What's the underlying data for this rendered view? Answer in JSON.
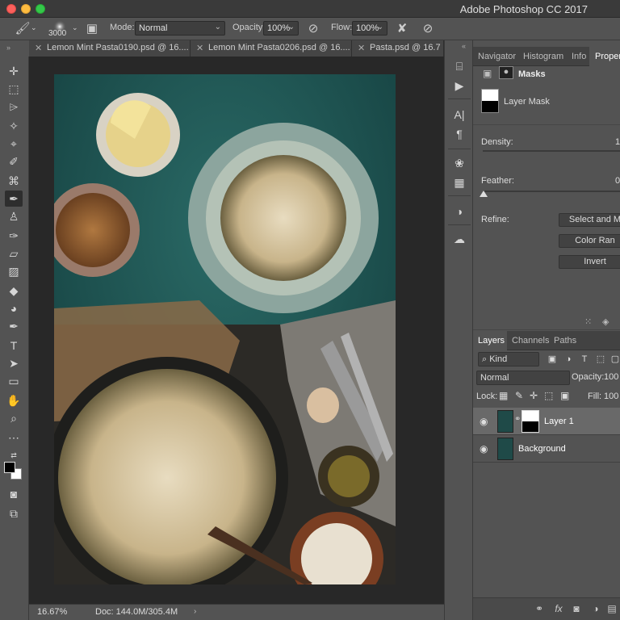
{
  "window": {
    "title": "Adobe Photoshop CC 2017"
  },
  "options": {
    "brush_size": "3000",
    "mode_label": "Mode:",
    "mode_value": "Normal",
    "opacity_label": "Opacity:",
    "opacity_value": "100%",
    "flow_label": "Flow:",
    "flow_value": "100%"
  },
  "tabs": [
    {
      "label": "Lemon Mint Pasta0190.psd @ 16....",
      "active": false
    },
    {
      "label": "Lemon Mint Pasta0206.psd @ 16....",
      "active": true
    },
    {
      "label": "Pasta.psd @ 16.7",
      "active": false
    }
  ],
  "status": {
    "zoom": "16.67%",
    "doc": "Doc: 144.0M/305.4M"
  },
  "top_panel_tabs": [
    "Navigator",
    "Histogram",
    "Info",
    "Properties"
  ],
  "properties": {
    "masks_title": "Masks",
    "layer_mask_label": "Layer Mask",
    "density_label": "Density:",
    "density_value": "1",
    "feather_label": "Feather:",
    "feather_value": "0",
    "refine_label": "Refine:",
    "select_and_mask": "Select and M",
    "color_range": "Color Ran",
    "invert": "Invert"
  },
  "layers_panel": {
    "tabs": [
      "Layers",
      "Channels",
      "Paths"
    ],
    "filter": "Kind",
    "blend": "Normal",
    "opacity_label": "Opacity:",
    "opacity_value": "100",
    "lock_label": "Lock:",
    "fill_label": "Fill:",
    "fill_value": "100",
    "layers": [
      {
        "name": "Layer 1",
        "has_mask": true,
        "selected": true
      },
      {
        "name": "Background",
        "has_mask": false,
        "selected": false
      }
    ]
  },
  "colors": {
    "foreground": "#000000",
    "background": "#ffffff",
    "accent": "#535353"
  }
}
